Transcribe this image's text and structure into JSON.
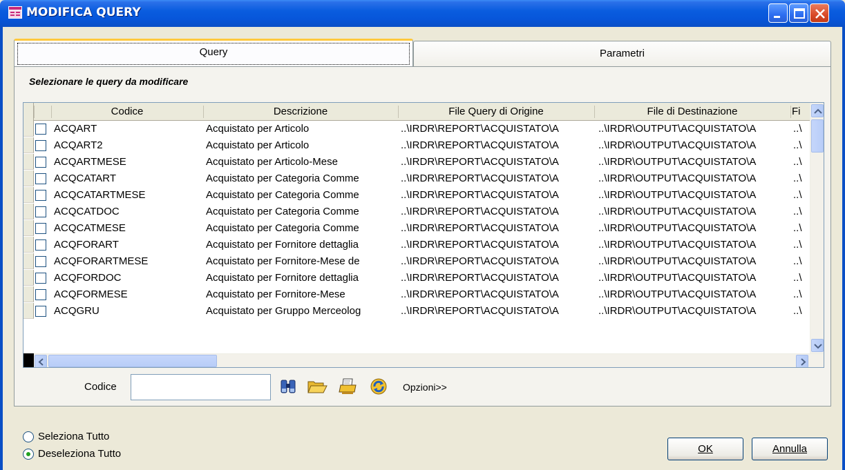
{
  "window": {
    "title": "MODIFICA QUERY"
  },
  "tabs": [
    {
      "label": "Query",
      "active": true
    },
    {
      "label": "Parametri",
      "active": false
    }
  ],
  "subtitle": "Selezionare le query da modificare",
  "grid": {
    "columns": [
      "Codice",
      "Descrizione",
      "File Query di Origine",
      "File di Destinazione",
      "Fi"
    ],
    "rows": [
      {
        "codice": "ACQART",
        "descrizione": "Acquistato per Articolo",
        "origine": "..\\IRDR\\REPORT\\ACQUISTATO\\A",
        "destinazione": "..\\IRDR\\OUTPUT\\ACQUISTATO\\A",
        "fi": "..\\"
      },
      {
        "codice": "ACQART2",
        "descrizione": "Acquistato per Articolo",
        "origine": "..\\IRDR\\REPORT\\ACQUISTATO\\A",
        "destinazione": "..\\IRDR\\OUTPUT\\ACQUISTATO\\A",
        "fi": "..\\"
      },
      {
        "codice": "ACQARTMESE",
        "descrizione": "Acquistato per Articolo-Mese",
        "origine": "..\\IRDR\\REPORT\\ACQUISTATO\\A",
        "destinazione": "..\\IRDR\\OUTPUT\\ACQUISTATO\\A",
        "fi": "..\\"
      },
      {
        "codice": "ACQCATART",
        "descrizione": "Acquistato per Categoria Comme",
        "origine": "..\\IRDR\\REPORT\\ACQUISTATO\\A",
        "destinazione": "..\\IRDR\\OUTPUT\\ACQUISTATO\\A",
        "fi": "..\\"
      },
      {
        "codice": "ACQCATARTMESE",
        "descrizione": "Acquistato per Categoria Comme",
        "origine": "..\\IRDR\\REPORT\\ACQUISTATO\\A",
        "destinazione": "..\\IRDR\\OUTPUT\\ACQUISTATO\\A",
        "fi": "..\\"
      },
      {
        "codice": "ACQCATDOC",
        "descrizione": "Acquistato per Categoria Comme",
        "origine": "..\\IRDR\\REPORT\\ACQUISTATO\\A",
        "destinazione": "..\\IRDR\\OUTPUT\\ACQUISTATO\\A",
        "fi": "..\\"
      },
      {
        "codice": "ACQCATMESE",
        "descrizione": "Acquistato per Categoria Comme",
        "origine": "..\\IRDR\\REPORT\\ACQUISTATO\\A",
        "destinazione": "..\\IRDR\\OUTPUT\\ACQUISTATO\\A",
        "fi": "..\\"
      },
      {
        "codice": "ACQFORART",
        "descrizione": "Acquistato per Fornitore dettaglia",
        "origine": "..\\IRDR\\REPORT\\ACQUISTATO\\A",
        "destinazione": "..\\IRDR\\OUTPUT\\ACQUISTATO\\A",
        "fi": "..\\"
      },
      {
        "codice": "ACQFORARTMESE",
        "descrizione": "Acquistato per Fornitore-Mese de",
        "origine": "..\\IRDR\\REPORT\\ACQUISTATO\\A",
        "destinazione": "..\\IRDR\\OUTPUT\\ACQUISTATO\\A",
        "fi": "..\\"
      },
      {
        "codice": "ACQFORDOC",
        "descrizione": "Acquistato per Fornitore dettaglia",
        "origine": "..\\IRDR\\REPORT\\ACQUISTATO\\A",
        "destinazione": "..\\IRDR\\OUTPUT\\ACQUISTATO\\A",
        "fi": "..\\"
      },
      {
        "codice": "ACQFORMESE",
        "descrizione": "Acquistato per Fornitore-Mese",
        "origine": "..\\IRDR\\REPORT\\ACQUISTATO\\A",
        "destinazione": "..\\IRDR\\OUTPUT\\ACQUISTATO\\A",
        "fi": "..\\"
      },
      {
        "codice": "ACQGRU",
        "descrizione": "Acquistato per Gruppo Merceolog",
        "origine": "..\\IRDR\\REPORT\\ACQUISTATO\\A",
        "destinazione": "..\\IRDR\\OUTPUT\\ACQUISTATO\\A",
        "fi": "..\\"
      }
    ]
  },
  "search": {
    "label": "Codice",
    "value": "",
    "options_label": "Opzioni>>"
  },
  "selection": {
    "select_all": "Seleziona Tutto",
    "deselect_all": "Deseleziona Tutto",
    "selected": "deselect_all"
  },
  "buttons": {
    "ok": "OK",
    "cancel": "Annulla"
  },
  "colors": {
    "titlebar": "#0a5ddf",
    "active_tab_accent": "#ffc83c",
    "close_button": "#d94a28",
    "window_bg": "#ece9d8"
  }
}
